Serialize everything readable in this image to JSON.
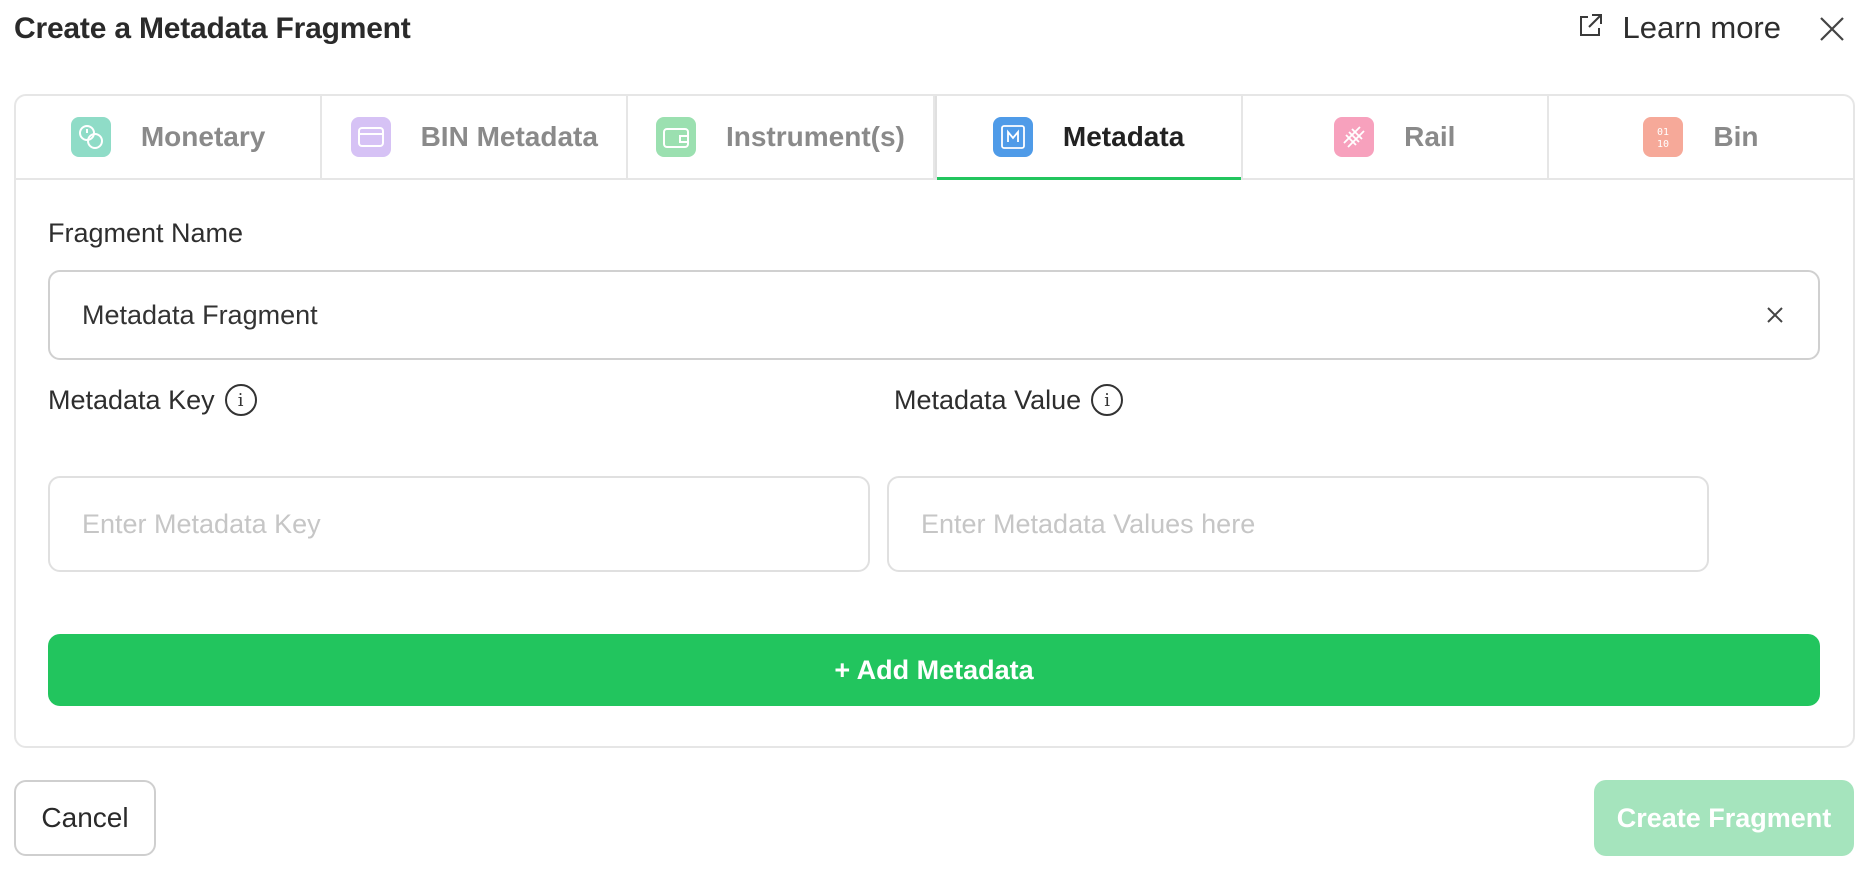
{
  "dialog": {
    "title": "Create a Metadata Fragment",
    "learn_more": "Learn more"
  },
  "tabs": [
    {
      "label": "Monetary",
      "icon": "coins-icon",
      "color": "#8fdcc7",
      "active": false
    },
    {
      "label": "BIN Metadata",
      "icon": "card-icon",
      "color": "#d6c2f5",
      "active": false
    },
    {
      "label": "Instrument(s)",
      "icon": "wallet-icon",
      "color": "#9be0b0",
      "active": false
    },
    {
      "label": "Metadata",
      "icon": "metadata-m-icon",
      "color": "#4f9be8",
      "active": true
    },
    {
      "label": "Rail",
      "icon": "rail-track-icon",
      "color": "#f7a1bd",
      "active": false
    },
    {
      "label": "Bin",
      "icon": "binary-icon",
      "color": "#f6a999",
      "active": false
    }
  ],
  "form": {
    "fragment_name_label": "Fragment Name",
    "fragment_name_value": "Metadata Fragment",
    "metadata_key_label": "Metadata Key",
    "metadata_key_placeholder": "Enter Metadata Key",
    "metadata_value_label": "Metadata Value",
    "metadata_value_placeholder": "Enter Metadata Values here",
    "add_metadata_label": "+ Add Metadata"
  },
  "footer": {
    "cancel_label": "Cancel",
    "create_label": "Create Fragment"
  },
  "colors": {
    "accent": "#22c55e",
    "accent_disabled": "#a5e4bd"
  }
}
